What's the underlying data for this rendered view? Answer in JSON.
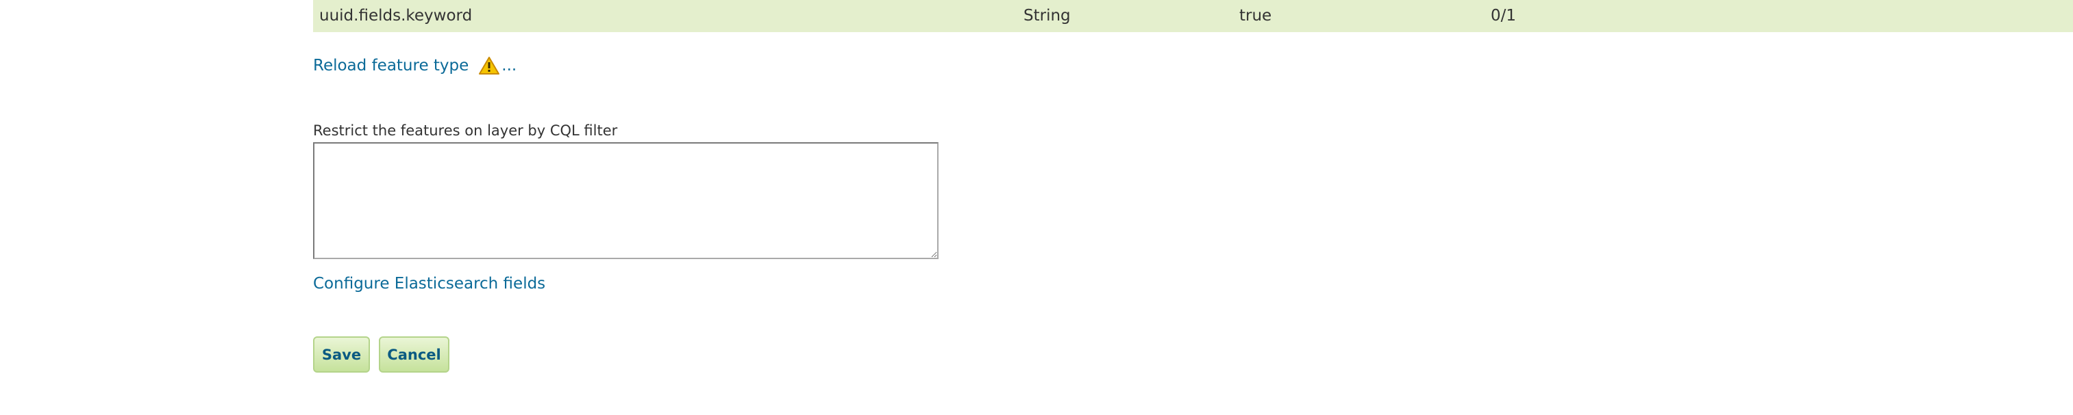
{
  "attribute_row": {
    "name": "uuid.fields.keyword",
    "type": "String",
    "nillable": "true",
    "multiplicity": "0/1"
  },
  "reload": {
    "label": "Reload feature type",
    "ellipsis": "..."
  },
  "cql": {
    "label": "Restrict the features on layer by CQL filter",
    "value": ""
  },
  "configure_link": "Configure Elasticsearch fields",
  "buttons": {
    "save": "Save",
    "cancel": "Cancel"
  },
  "colors": {
    "row_background": "#e4efcd",
    "link": "#0b6a98",
    "button_text": "#0b5a82",
    "warning": "#f5b400"
  },
  "icons": {
    "warning": "warning-icon"
  }
}
